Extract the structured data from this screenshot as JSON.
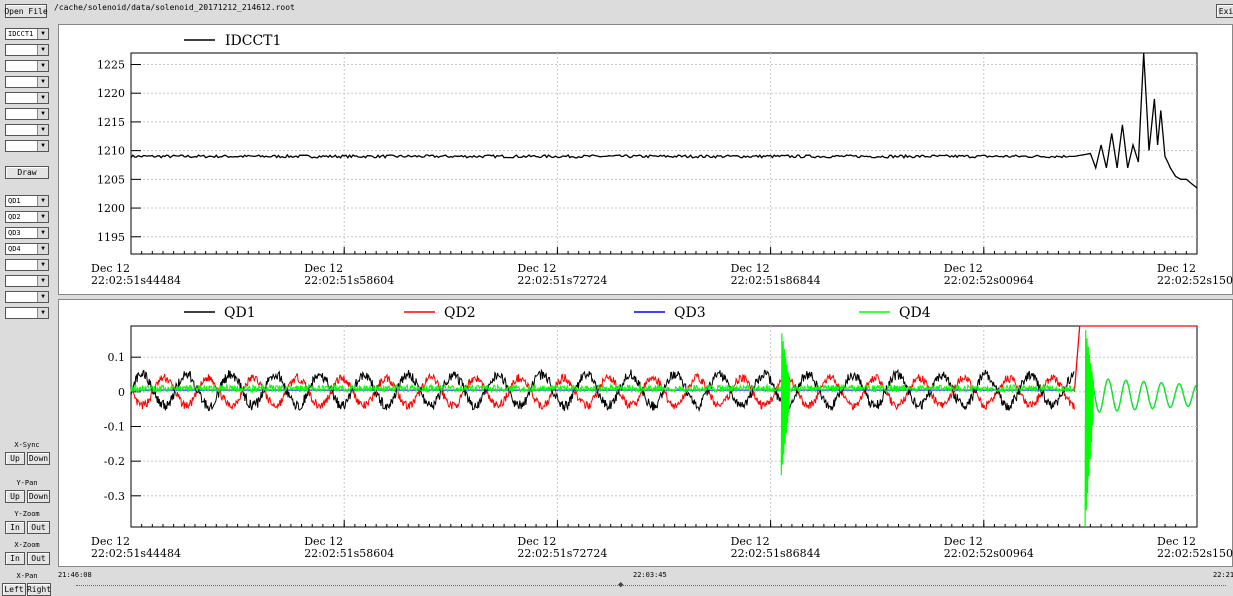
{
  "toolbar": {
    "open_file": "Open File",
    "path": "/cache/solenoid/data/solenoid_20171212_214612.root",
    "exit": "Exi"
  },
  "top_selectors": [
    "IDCCT1",
    "",
    "",
    "",
    "",
    "",
    "",
    ""
  ],
  "draw_button": "Draw",
  "bottom_selectors": [
    "QD1",
    "QD2",
    "QD3",
    "QD4",
    "",
    "",
    "",
    ""
  ],
  "controls": {
    "xsync": {
      "label": "X-Sync",
      "a": "Up",
      "b": "Down"
    },
    "ypan": {
      "label": "Y-Pan",
      "a": "Up",
      "b": "Down"
    },
    "yzoom": {
      "label": "Y-Zoom",
      "a": "In",
      "b": "Out"
    },
    "xzoom": {
      "label": "X-Zoom",
      "a": "In",
      "b": "Out"
    },
    "xpan": {
      "label": "X-Pan",
      "a": "Left",
      "b": "Right"
    }
  },
  "timeline": {
    "start": "21:46:08",
    "mid": "22:03:45",
    "end": "22:21"
  },
  "colors": {
    "idcct1": "#000000",
    "qd1": "#000000",
    "qd2": "#ff0000",
    "qd3": "#0000ff",
    "qd4": "#00ff00",
    "grid": "#c8c8c8"
  },
  "chart_data": [
    {
      "type": "line",
      "xlabel": "",
      "ylabel": "",
      "x_ticks": [
        {
          "day": "Dec 12",
          "time": "22:02:51s44484"
        },
        {
          "day": "Dec 12",
          "time": "22:02:51s58604"
        },
        {
          "day": "Dec 12",
          "time": "22:02:51s72724"
        },
        {
          "day": "Dec 12",
          "time": "22:02:51s86844"
        },
        {
          "day": "Dec 12",
          "time": "22:02:52s00964"
        },
        {
          "day": "Dec 12",
          "time": "22:02:52s15084"
        }
      ],
      "y_ticks": [
        "1195",
        "1200",
        "1205",
        "1210",
        "1215",
        "1220",
        "1225"
      ],
      "ylim": [
        1192,
        1227
      ],
      "grid": true,
      "legend": "top-left",
      "series": [
        {
          "name": "IDCCT1",
          "x": [
            0,
            0.2,
            0.4,
            0.6,
            0.8,
            0.885,
            0.9,
            0.905,
            0.91,
            0.915,
            0.92,
            0.925,
            0.93,
            0.935,
            0.94,
            0.945,
            0.95,
            0.955,
            0.96,
            0.963,
            0.966,
            0.97,
            0.975,
            0.98,
            0.985,
            0.99,
            1.0
          ],
          "y": [
            1209,
            1209,
            1209,
            1209,
            1209,
            1209,
            1209.5,
            1207,
            1211,
            1207,
            1213,
            1207,
            1214.5,
            1207,
            1211,
            1208,
            1227,
            1210,
            1219,
            1211,
            1217,
            1209,
            1207,
            1205.5,
            1205,
            1205,
            1203.5
          ]
        }
      ]
    },
    {
      "type": "line",
      "xlabel": "",
      "ylabel": "",
      "x_ticks": [
        {
          "day": "Dec 12",
          "time": "22:02:51s44484"
        },
        {
          "day": "Dec 12",
          "time": "22:02:51s58604"
        },
        {
          "day": "Dec 12",
          "time": "22:02:51s72724"
        },
        {
          "day": "Dec 12",
          "time": "22:02:51s86844"
        },
        {
          "day": "Dec 12",
          "time": "22:02:52s00964"
        },
        {
          "day": "Dec 12",
          "time": "22:02:52s15084"
        }
      ],
      "y_ticks": [
        "-0.3",
        "-0.2",
        "-0.1",
        "0",
        "0.1"
      ],
      "ylim": [
        -0.39,
        0.19
      ],
      "grid": true,
      "legend": "top",
      "series": [
        {
          "name": "QD1",
          "shape": "sine",
          "amplitude": 0.045,
          "noise": 0.015,
          "cycles": 24,
          "phase": 0,
          "offset": 0.005,
          "end_x": 0.885
        },
        {
          "name": "QD2",
          "shape": "sine",
          "amplitude": 0.04,
          "noise": 0.012,
          "cycles": 24,
          "phase": 3.14,
          "offset": 0.0,
          "end_x": 0.885,
          "tail": {
            "x": [
              0.885,
              0.89,
              0.9,
              0.93,
              1.0
            ],
            "y": [
              0.0,
              0.19,
              0.19,
              0.19,
              0.19
            ]
          }
        },
        {
          "name": "QD3",
          "shape": "flat",
          "offset": 0.005,
          "end_x": 0.885,
          "tail_wave": {
            "x0": 0.9,
            "amplitude": 0.05,
            "cycles": 6
          }
        },
        {
          "name": "QD4",
          "shape": "flat_noisy",
          "offset": 0.01,
          "noise": 0.01,
          "end_x": 0.885,
          "spikes": [
            {
              "x": 0.61,
              "min": -0.24,
              "max": 0.18
            },
            {
              "x": 0.895,
              "min": -0.39,
              "max": 0.19
            }
          ],
          "tail_wave": {
            "x0": 0.9,
            "amplitude": 0.05,
            "cycles": 6
          }
        }
      ]
    }
  ]
}
